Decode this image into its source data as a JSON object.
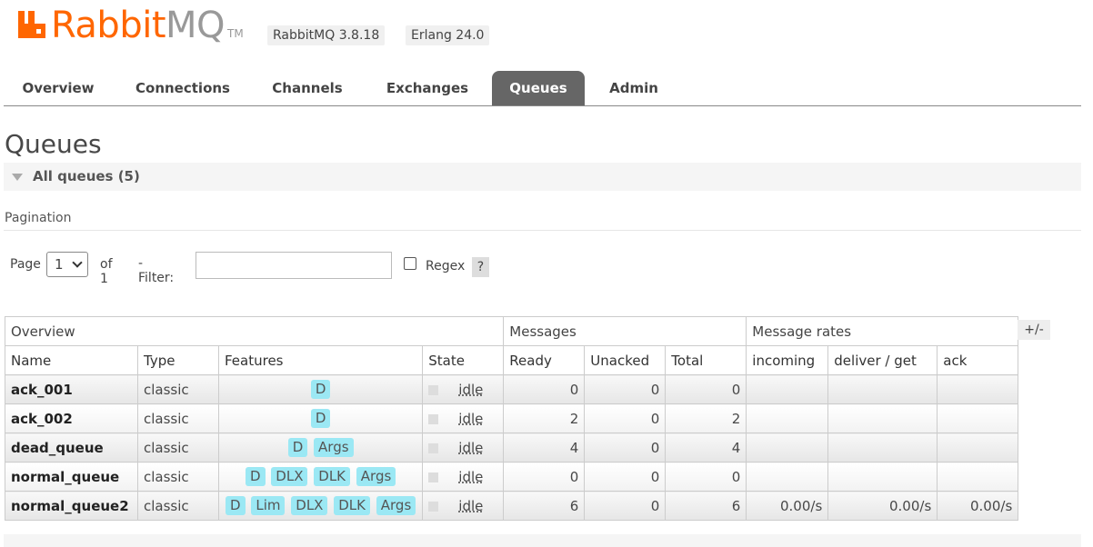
{
  "header": {
    "logo_word": "Rabbit",
    "logo_mq": "MQ",
    "logo_tm": "TM",
    "rabbitmq_version": "RabbitMQ 3.8.18",
    "erlang_version": "Erlang 24.0",
    "brand_color": "#ff6600"
  },
  "tabs": [
    {
      "label": "Overview",
      "active": false
    },
    {
      "label": "Connections",
      "active": false
    },
    {
      "label": "Channels",
      "active": false
    },
    {
      "label": "Exchanges",
      "active": false
    },
    {
      "label": "Queues",
      "active": true
    },
    {
      "label": "Admin",
      "active": false
    }
  ],
  "page_title": "Queues",
  "section": {
    "title": "All queues (5)"
  },
  "pagination": {
    "label": "Pagination",
    "page_label": "Page",
    "page_value": "1",
    "of_label": "of 1",
    "filter_label": "- Filter:",
    "filter_value": "",
    "regex_label": "Regex",
    "help_label": "?"
  },
  "table": {
    "groups": [
      "Overview",
      "Messages",
      "Message rates"
    ],
    "columns": [
      "Name",
      "Type",
      "Features",
      "State",
      "Ready",
      "Unacked",
      "Total",
      "incoming",
      "deliver / get",
      "ack"
    ],
    "toggle_label": "+/-",
    "rows": [
      {
        "name": "ack_001",
        "type": "classic",
        "features": [
          "D"
        ],
        "state": "idle",
        "ready": "0",
        "unacked": "0",
        "total": "0",
        "incoming": "",
        "deliver_get": "",
        "ack": ""
      },
      {
        "name": "ack_002",
        "type": "classic",
        "features": [
          "D"
        ],
        "state": "idle",
        "ready": "2",
        "unacked": "0",
        "total": "2",
        "incoming": "",
        "deliver_get": "",
        "ack": ""
      },
      {
        "name": "dead_queue",
        "type": "classic",
        "features": [
          "D",
          "Args"
        ],
        "state": "idle",
        "ready": "4",
        "unacked": "0",
        "total": "4",
        "incoming": "",
        "deliver_get": "",
        "ack": ""
      },
      {
        "name": "normal_queue",
        "type": "classic",
        "features": [
          "D",
          "DLX",
          "DLK",
          "Args"
        ],
        "state": "idle",
        "ready": "0",
        "unacked": "0",
        "total": "0",
        "incoming": "",
        "deliver_get": "",
        "ack": ""
      },
      {
        "name": "normal_queue2",
        "type": "classic",
        "features": [
          "D",
          "Lim",
          "DLX",
          "DLK",
          "Args"
        ],
        "state": "idle",
        "ready": "6",
        "unacked": "0",
        "total": "6",
        "incoming": "0.00/s",
        "deliver_get": "0.00/s",
        "ack": "0.00/s"
      }
    ]
  }
}
